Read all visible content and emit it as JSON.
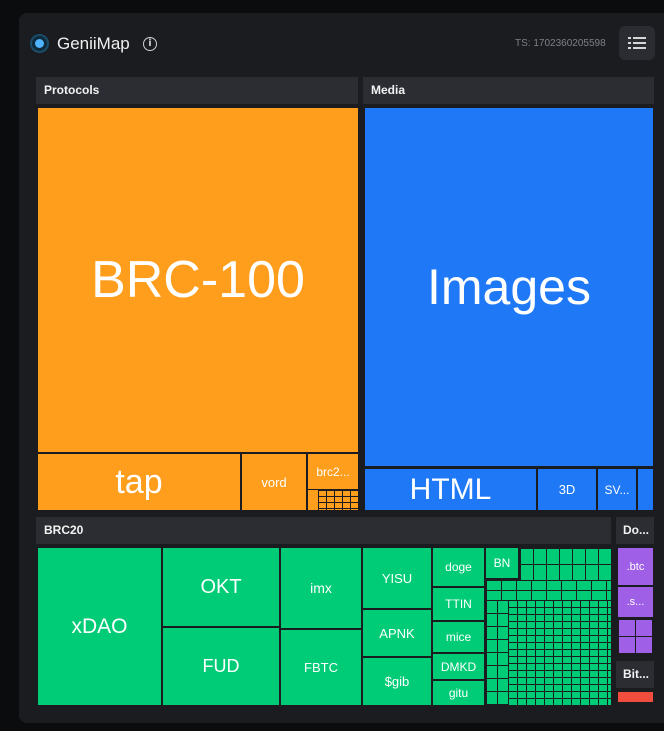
{
  "app": {
    "title": "GeniiMap",
    "timestamp": "TS: 1702360205598"
  },
  "icons": {
    "logo": "genii-logo-icon",
    "info": "info-icon",
    "menu": "list-menu-icon"
  },
  "colors": {
    "protocols": "#ff9d1c",
    "media": "#1f78f5",
    "brc20": "#00cc77",
    "domains": "#9f5fe6",
    "bitmap": "#f04d3e"
  },
  "sections": {
    "protocols": {
      "label": "Protocols",
      "tiles": {
        "brc100": "BRC-100",
        "tap": "tap",
        "vord": "vord",
        "brc2": "brc2..."
      }
    },
    "media": {
      "label": "Media",
      "tiles": {
        "images": "Images",
        "html": "HTML",
        "threed": "3D",
        "svg": "SV..."
      }
    },
    "brc20": {
      "label": "BRC20",
      "tiles": {
        "xdao": "xDAO",
        "okt": "OKT",
        "fud": "FUD",
        "imx": "imx",
        "fbtc": "FBTC",
        "yisu": "YISU",
        "apnk": "APNK",
        "gib": "$gib",
        "doge": "doge",
        "ttin": "TTIN",
        "mice": "mice",
        "dmkd": "DMKD",
        "gitu": "gitu",
        "bn": "BN"
      }
    },
    "domains": {
      "label": "Do...",
      "tiles": {
        "btc": ".btc",
        "s": ".s..."
      }
    },
    "bitmap": {
      "label": "Bit..."
    }
  }
}
